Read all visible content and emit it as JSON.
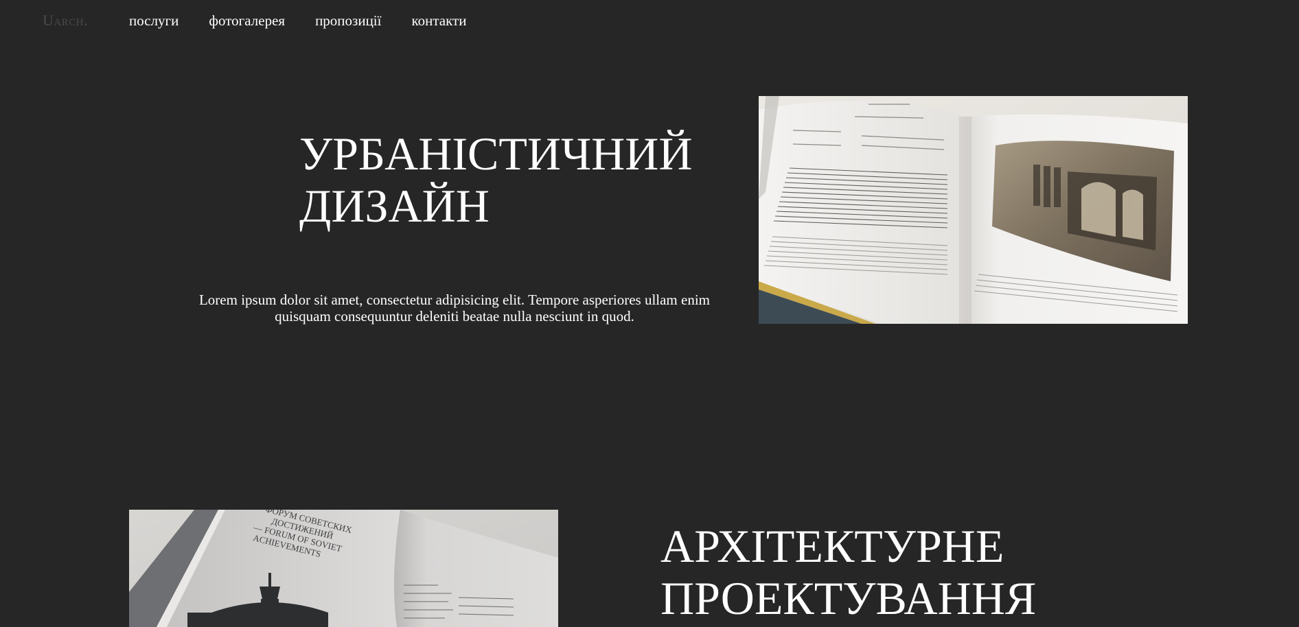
{
  "header": {
    "logo": "Uarch.",
    "nav": [
      {
        "label": "послуги"
      },
      {
        "label": "фотогалерея"
      },
      {
        "label": "пропозиції"
      },
      {
        "label": "контакти"
      }
    ]
  },
  "section1": {
    "title_line1": "УРБАНІСТИЧНИЙ",
    "title_line2": "ДИЗАЙН",
    "description": "Lorem ipsum dolor sit amet, consectetur adipisicing elit. Tempore asperiores ullam enim quisquam consequuntur deleniti beatae nulla nesciunt in quod."
  },
  "section2": {
    "title_line1": "АРХІТЕКТУРНЕ",
    "title_line2": "ПРОЕКТУВАННЯ",
    "image_caption_lines": [
      "ФОРУМ СОВЕТСКИХ",
      "ДОСТИЖЕНИЙ",
      "— FORUM OF SOVIET",
      "ACHIEVEMENTS"
    ]
  },
  "colors": {
    "background": "#262626",
    "text": "#ffffff",
    "logo": "#4a4a4a"
  }
}
